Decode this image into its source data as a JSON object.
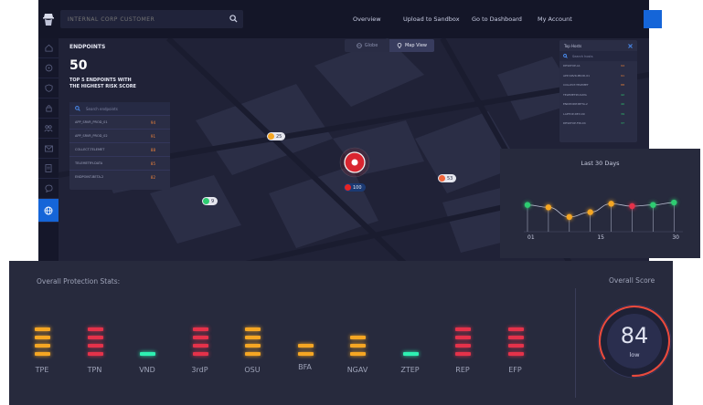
{
  "header": {
    "search_placeholder": "INTERNAL CORP CUSTOMER",
    "nav": [
      "Overview",
      "Upload to Sandbox",
      "Go to Dashboard",
      "My Account"
    ]
  },
  "sidebar": {
    "items": [
      "home-icon",
      "dashboard-icon",
      "shield-icon",
      "lock-icon",
      "users-icon",
      "mail-icon",
      "doc-icon",
      "chat-icon",
      "globe-icon"
    ],
    "active_index": 8
  },
  "view_toggle": {
    "globe": "Globe",
    "map": "Map View",
    "selected": "Map View"
  },
  "endpoints": {
    "title": "ENDPOINTS",
    "count": "50",
    "subtitle_line1": "TOP 5 ENDPOINTS WITH",
    "subtitle_line2": "THE HIGHEST RISK SCORE",
    "search_placeholder": "Search endpoints",
    "rows": [
      {
        "name": "APP_SRVR_PROD_01",
        "score": "94"
      },
      {
        "name": "APP_SRVR_PROD_02",
        "score": "91"
      },
      {
        "name": "COLLECT-TELEMET",
        "score": "88"
      },
      {
        "name": "TELEMETRY-DATA",
        "score": "85"
      },
      {
        "name": "ENDPOINT-BETA-2",
        "score": "82"
      }
    ]
  },
  "right_panel": {
    "title": "Top Hosts",
    "search_placeholder": "Search hosts",
    "rows": [
      {
        "name": "DESKTOP-A1",
        "score": "94",
        "color": "#f0843a"
      },
      {
        "name": "APP-SRVR-PROD-01",
        "score": "91",
        "color": "#f0843a"
      },
      {
        "name": "COLLECT-TELEMET",
        "score": "88",
        "color": "#f0843a"
      },
      {
        "name": "TELEMETRY-DATA",
        "score": "42",
        "color": "#2ecc71"
      },
      {
        "name": "ENDPOINT-BETA-2",
        "score": "40",
        "color": "#2ecc71"
      },
      {
        "name": "LAPTOP-DEV-09",
        "score": "39",
        "color": "#2ecc71"
      },
      {
        "name": "DESKTOP-FIN-04",
        "score": "37",
        "color": "#2ecc71"
      }
    ]
  },
  "map_markers": [
    {
      "value": "25",
      "color": "#f5a623"
    },
    {
      "value": "53",
      "color": "#f0643a"
    },
    {
      "value": "100",
      "color": "#e52424"
    },
    {
      "value": "9",
      "color": "#2ecc71"
    }
  ],
  "chart_data": {
    "type": "line",
    "title": "Last 30 Days",
    "x": [
      1,
      5,
      9,
      13,
      17,
      21,
      25,
      29
    ],
    "values": [
      76,
      74,
      66,
      70,
      77,
      75,
      76,
      78
    ],
    "point_colors": [
      "#2ecc71",
      "#f5a623",
      "#f5a623",
      "#f5a623",
      "#f5a623",
      "#e5324a",
      "#2ecc71",
      "#2ecc71"
    ],
    "xticks": [
      "01",
      "15",
      "30"
    ],
    "xlim": [
      1,
      30
    ],
    "ylim": [
      50,
      100
    ]
  },
  "stats": {
    "title": "Overall Protection Stats:",
    "items": [
      {
        "label": "TPE",
        "level": 4,
        "color": "#f5a623"
      },
      {
        "label": "TPN",
        "level": 4,
        "color": "#e5324a"
      },
      {
        "label": "VND",
        "level": 1,
        "color": "#2ef0b2"
      },
      {
        "label": "3rdP",
        "level": 4,
        "color": "#e5324a"
      },
      {
        "label": "OSU",
        "level": 4,
        "color": "#f5a623"
      },
      {
        "label": "BFA",
        "level": 2,
        "color": "#f5a623"
      },
      {
        "label": "NGAV",
        "level": 3,
        "color": "#f5a623"
      },
      {
        "label": "ZTEP",
        "level": 1,
        "color": "#2ef0b2"
      },
      {
        "label": "REP",
        "level": 4,
        "color": "#e5324a"
      },
      {
        "label": "EFP",
        "level": 4,
        "color": "#e5324a"
      }
    ]
  },
  "score": {
    "title": "Overall Score",
    "value": "84",
    "label": "low",
    "fraction": 0.84,
    "color": "#e84a3d"
  }
}
